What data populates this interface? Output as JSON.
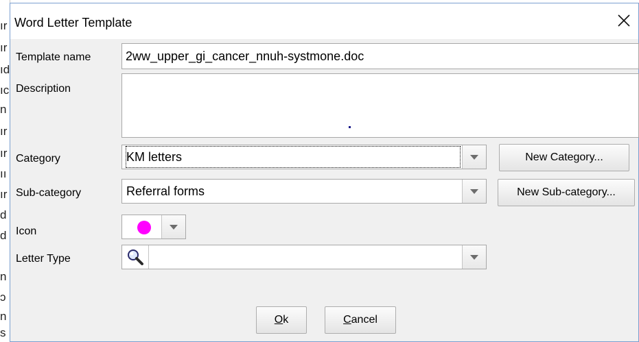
{
  "window": {
    "title": "Word Letter Template",
    "close_glyph": "╳"
  },
  "background": {
    "left_chars": [
      "ır",
      "ır",
      "ıd",
      "ıc",
      "n",
      "ır",
      "ır",
      "ıı",
      "ır",
      "d",
      "d",
      "",
      "n",
      "ɔ",
      "n",
      "s"
    ]
  },
  "form": {
    "template_name": {
      "label": "Template name",
      "value": "2ww_upper_gi_cancer_nnuh-systmone.doc"
    },
    "description": {
      "label": "Description",
      "value": ""
    },
    "category": {
      "label": "Category",
      "value": "KM letters"
    },
    "subcategory": {
      "label": "Sub-category",
      "value": "Referral forms"
    },
    "icon": {
      "label": "Icon",
      "color": "#ff00ff"
    },
    "letter_type": {
      "label": "Letter Type",
      "value": "",
      "lookup_icon": "magnifier-icon"
    }
  },
  "buttons": {
    "new_category": "New Category...",
    "new_subcategory": "New Sub-category...",
    "ok_mnemonic": "O",
    "ok_rest": "k",
    "cancel_mnemonic": "C",
    "cancel_rest": "ancel"
  }
}
